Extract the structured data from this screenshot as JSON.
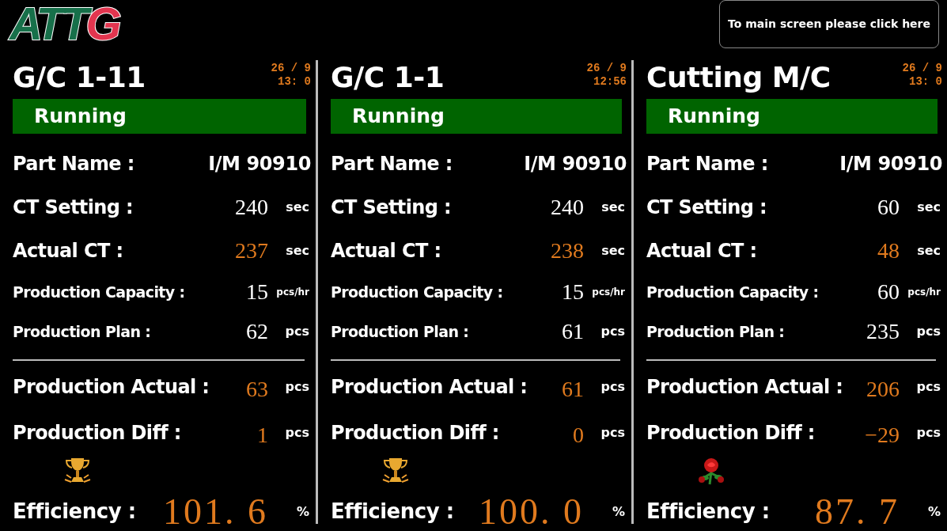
{
  "logo": {
    "parts": [
      {
        "text": "ATT",
        "color": "#17704a"
      },
      {
        "text": "G",
        "color": "#e2354f"
      }
    ]
  },
  "main_button": {
    "label": "To main screen please click here"
  },
  "machines": [
    {
      "name": "G/C 1-11",
      "date": "26 / 9",
      "time": "13: 0",
      "status": {
        "text": "Running",
        "kind": "running"
      },
      "rows": [
        {
          "kind": "large",
          "label": "Part Name :",
          "value": "I/M 90910"
        },
        {
          "kind": "large",
          "label": "CT Setting :",
          "value": "240",
          "unit": "sec",
          "highlight": false
        },
        {
          "kind": "large",
          "label": "Actual CT :",
          "value": "237",
          "unit": "sec",
          "highlight": true
        },
        {
          "kind": "small",
          "label": "Production Capacity :",
          "value": "15",
          "unit": "pcs/hr",
          "highlight": false
        },
        {
          "kind": "small",
          "label": "Production Plan :",
          "value": "62",
          "unit": "pcs",
          "highlight": false
        }
      ],
      "results": [
        {
          "label": "Production Actual :",
          "value": "63",
          "unit": "pcs",
          "highlight": true
        },
        {
          "label": "Production Diff :",
          "value": "1",
          "unit": "pcs",
          "highlight": true
        }
      ],
      "award": {
        "kind": "trophy"
      },
      "efficiency": {
        "label": "Efficiency :",
        "value": "101. 6",
        "unit": "%"
      }
    },
    {
      "name": "G/C 1-1",
      "date": "26 / 9",
      "time": "12:56",
      "status": {
        "text": "Running",
        "kind": "running"
      },
      "rows": [
        {
          "kind": "large",
          "label": "Part Name :",
          "value": "I/M 90910"
        },
        {
          "kind": "large",
          "label": "CT Setting :",
          "value": "240",
          "unit": "sec",
          "highlight": false
        },
        {
          "kind": "large",
          "label": "Actual CT :",
          "value": "238",
          "unit": "sec",
          "highlight": true
        },
        {
          "kind": "small",
          "label": "Production Capacity :",
          "value": "15",
          "unit": "pcs/hr",
          "highlight": false
        },
        {
          "kind": "small",
          "label": "Production Plan :",
          "value": "61",
          "unit": "pcs",
          "highlight": false
        }
      ],
      "results": [
        {
          "label": "Production Actual :",
          "value": "61",
          "unit": "pcs",
          "highlight": true
        },
        {
          "label": "Production Diff :",
          "value": "0",
          "unit": "pcs",
          "highlight": true
        }
      ],
      "award": {
        "kind": "trophy"
      },
      "efficiency": {
        "label": "Efficiency :",
        "value": "100. 0",
        "unit": "%"
      }
    },
    {
      "name": "Cutting M/C",
      "date": "26 / 9",
      "time": "13: 0",
      "status": {
        "text": "Running",
        "kind": "running"
      },
      "rows": [
        {
          "kind": "large",
          "label": "Part Name :",
          "value": "I/M 90910"
        },
        {
          "kind": "large",
          "label": "CT Setting :",
          "value": "60",
          "unit": "sec",
          "highlight": false
        },
        {
          "kind": "large",
          "label": "Actual CT :",
          "value": "48",
          "unit": "sec",
          "highlight": true
        },
        {
          "kind": "small",
          "label": "Production Capacity :",
          "value": "60",
          "unit": "pcs/hr",
          "highlight": false
        },
        {
          "kind": "small",
          "label": "Production Plan :",
          "value": "235",
          "unit": "pcs",
          "highlight": false
        }
      ],
      "results": [
        {
          "label": "Production Actual :",
          "value": "206",
          "unit": "pcs",
          "highlight": true
        },
        {
          "label": "Production Diff :",
          "value": "−29",
          "unit": "pcs",
          "highlight": true
        }
      ],
      "award": {
        "kind": "rose"
      },
      "efficiency": {
        "label": "Efficiency :",
        "value": "87. 7",
        "unit": "%"
      }
    }
  ]
}
